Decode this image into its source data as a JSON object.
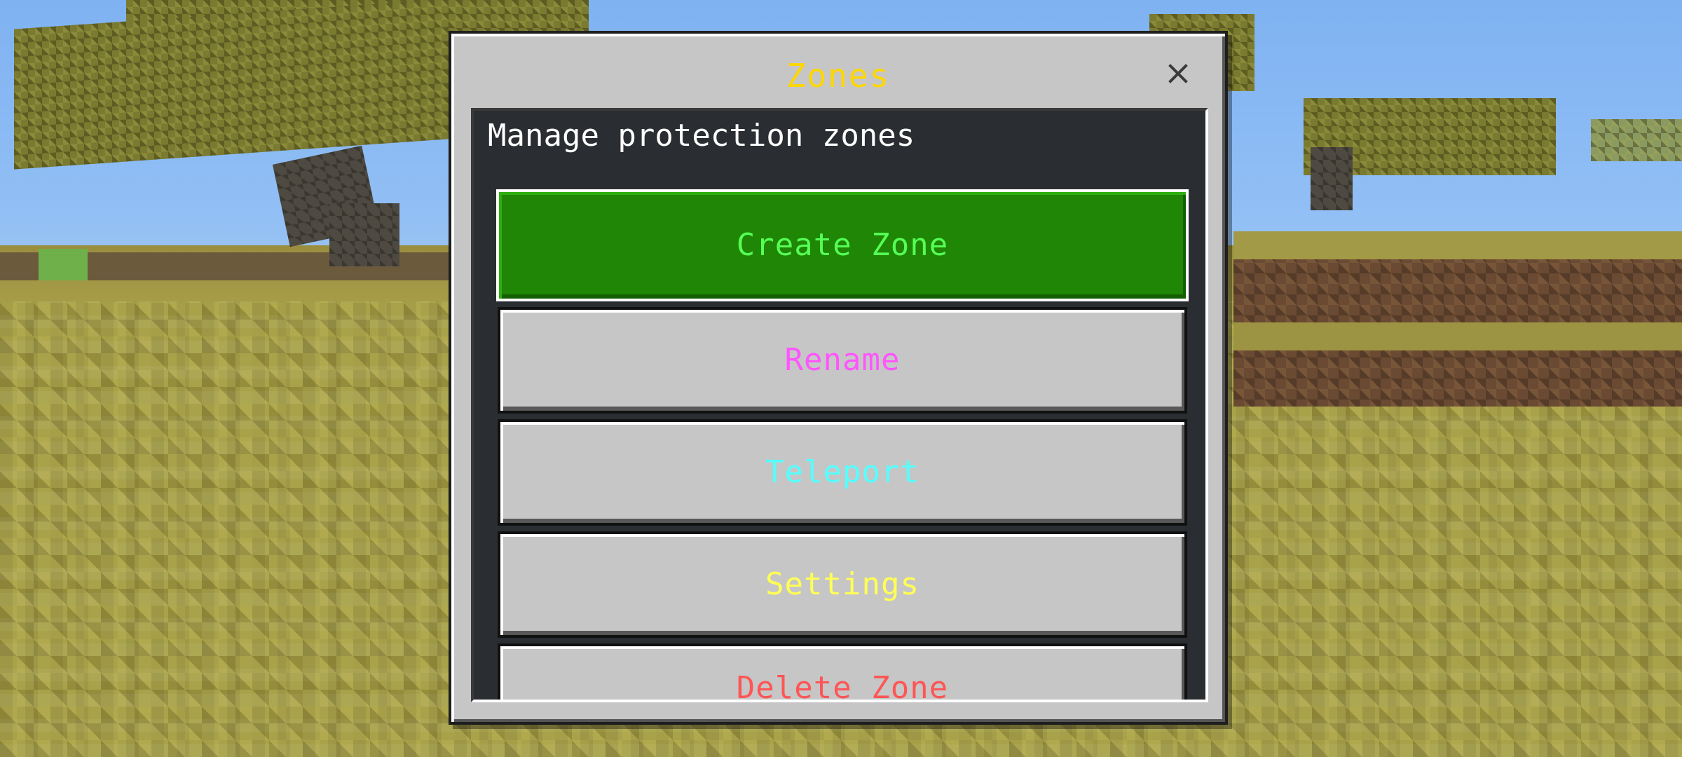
{
  "dialog": {
    "title": "Zones",
    "close_label": "×",
    "subtitle": "Manage protection zones"
  },
  "buttons": [
    {
      "label": "Create Zone",
      "color": "#55ff55",
      "selected": true
    },
    {
      "label": "Rename",
      "color": "#ff55ff",
      "selected": false
    },
    {
      "label": "Teleport",
      "color": "#55ffff",
      "selected": false
    },
    {
      "label": "Settings",
      "color": "#ffff55",
      "selected": false
    },
    {
      "label": "Delete Zone",
      "color": "#ff5555",
      "selected": false
    }
  ],
  "colors": {
    "title": "#ffd700",
    "panel": "#c6c6c6",
    "selected_button": "#1f8606"
  },
  "icons": {
    "close": "close-icon"
  }
}
